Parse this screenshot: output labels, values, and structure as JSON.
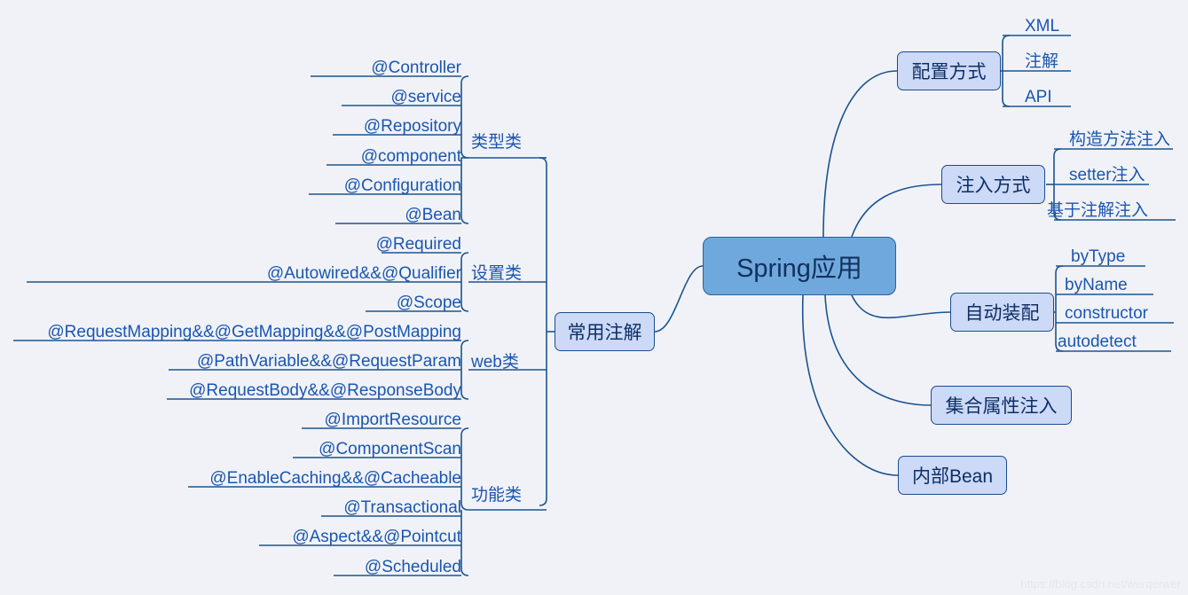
{
  "diagram": {
    "title": "Spring应用",
    "background_color": "#f1f2f7",
    "root_fill": "#6fa8dc",
    "node_fill": "#ccd9f7",
    "line_color": "#1a5490",
    "text_color": "#1a56b0"
  },
  "root": {
    "label": "Spring应用"
  },
  "left_branch": {
    "label": "常用注解",
    "categories": [
      {
        "label": "类型类",
        "items": [
          "@Controller",
          "@service",
          "@Repository",
          "@component",
          "@Configuration",
          "@Bean"
        ]
      },
      {
        "label": "设置类",
        "items": [
          "@Required",
          "@Autowired&&@Qualifier",
          "@Scope"
        ]
      },
      {
        "label": "web类",
        "items": [
          "@RequestMapping&&@GetMapping&&@PostMapping",
          "@PathVariable&&@RequestParam",
          "@RequestBody&&@ResponseBody"
        ]
      },
      {
        "label": "功能类",
        "items": [
          "@ImportResource",
          "@ComponentScan",
          "@EnableCaching&&@Cacheable",
          "@Transactional",
          "@Aspect&&@Pointcut",
          "@Scheduled"
        ]
      }
    ]
  },
  "right_branches": [
    {
      "label": "配置方式",
      "items": [
        "XML",
        "注解",
        "API"
      ]
    },
    {
      "label": "注入方式",
      "items": [
        "构造方法注入",
        "setter注入",
        "基于注解注入"
      ]
    },
    {
      "label": "自动装配",
      "items": [
        "byType",
        "byName",
        "constructor",
        "autodetect"
      ]
    },
    {
      "label": "集合属性注入",
      "items": []
    },
    {
      "label": "内部Bean",
      "items": []
    }
  ],
  "watermark": "https://blog.csdn.net/werqerwer"
}
